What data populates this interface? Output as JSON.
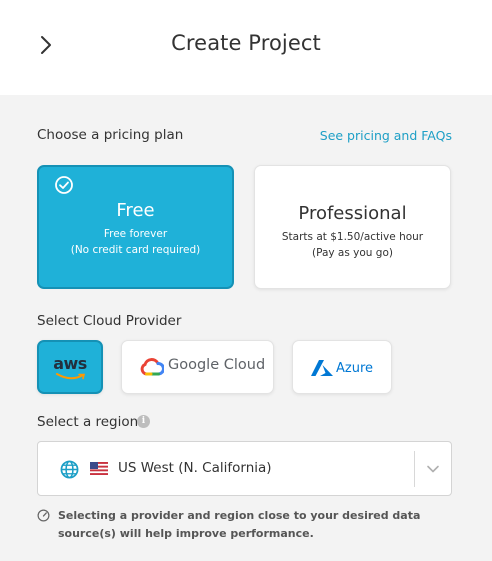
{
  "header": {
    "title": "Create Project",
    "back_icon": "chevron-right-icon"
  },
  "pricing": {
    "label": "Choose a pricing plan",
    "link": "See pricing and FAQs",
    "plans": [
      {
        "name": "Free",
        "line1": "Free forever",
        "line2": "(No credit card required)",
        "selected": true
      },
      {
        "name": "Professional",
        "line1": "Starts at $1.50/active hour",
        "line2": "(Pay as you go)",
        "selected": false
      }
    ]
  },
  "provider": {
    "label": "Select Cloud Provider",
    "options": [
      {
        "name": "aws",
        "selected": true
      },
      {
        "name": "Google Cloud",
        "selected": false
      },
      {
        "name": "Azure",
        "selected": false
      }
    ]
  },
  "region": {
    "label": "Select a region",
    "info_icon": "i",
    "value": "US West (N. California)",
    "hint": "Selecting a provider and region close to your desired data source(s) will help improve performance."
  },
  "colors": {
    "accent": "#1fb1d8",
    "accent_border": "#1591b5",
    "link": "#1d9fc6",
    "azure": "#0078d4"
  }
}
